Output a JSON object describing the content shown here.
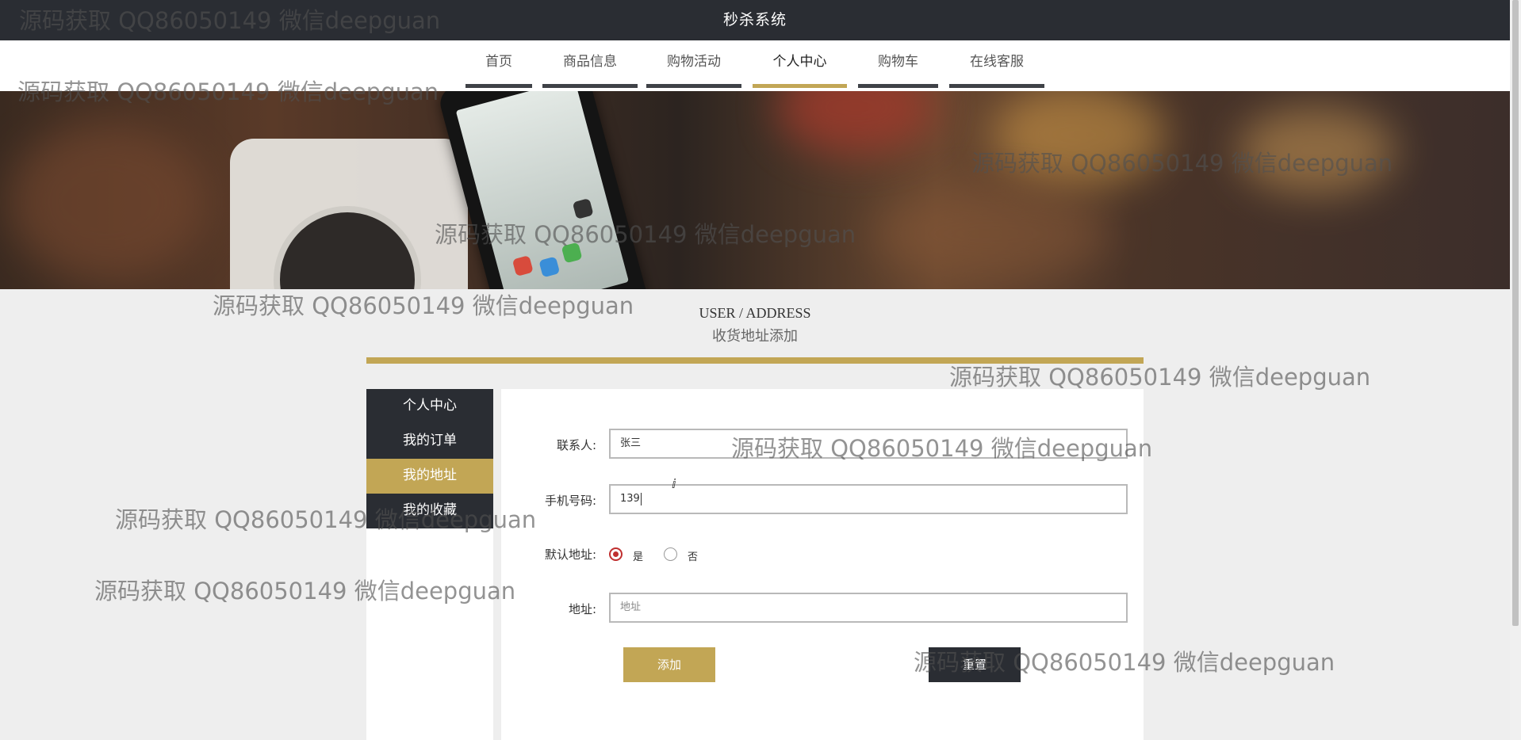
{
  "app": {
    "title": "秒杀系统"
  },
  "nav": {
    "items": [
      {
        "label": "首页",
        "active": false
      },
      {
        "label": "商品信息",
        "active": false
      },
      {
        "label": "购物活动",
        "active": false
      },
      {
        "label": "个人中心",
        "active": true
      },
      {
        "label": "购物车",
        "active": false
      },
      {
        "label": "在线客服",
        "active": false
      }
    ]
  },
  "section": {
    "title_en": "USER / ADDRESS",
    "title_cn": "收货地址添加"
  },
  "sidebar": {
    "items": [
      {
        "label": "个人中心",
        "active": false
      },
      {
        "label": "我的订单",
        "active": false
      },
      {
        "label": "我的地址",
        "active": true
      },
      {
        "label": "我的收藏",
        "active": false
      }
    ]
  },
  "form": {
    "contact": {
      "label": "联系人:",
      "value": "张三"
    },
    "phone": {
      "label": "手机号码:",
      "value": "139"
    },
    "default_address": {
      "label": "默认地址:",
      "options": [
        {
          "label": "是",
          "checked": true
        },
        {
          "label": "否",
          "checked": false
        }
      ]
    },
    "address": {
      "label": "地址:",
      "value": "",
      "placeholder": "地址"
    },
    "submit_label": "添加",
    "reset_label": "重置"
  },
  "watermark": {
    "text": "源码获取 QQ86050149 微信deepguan"
  },
  "colors": {
    "accent": "#c2a655",
    "dark": "#2a2d33",
    "background": "#eeeeee",
    "radio": "#c03030"
  }
}
